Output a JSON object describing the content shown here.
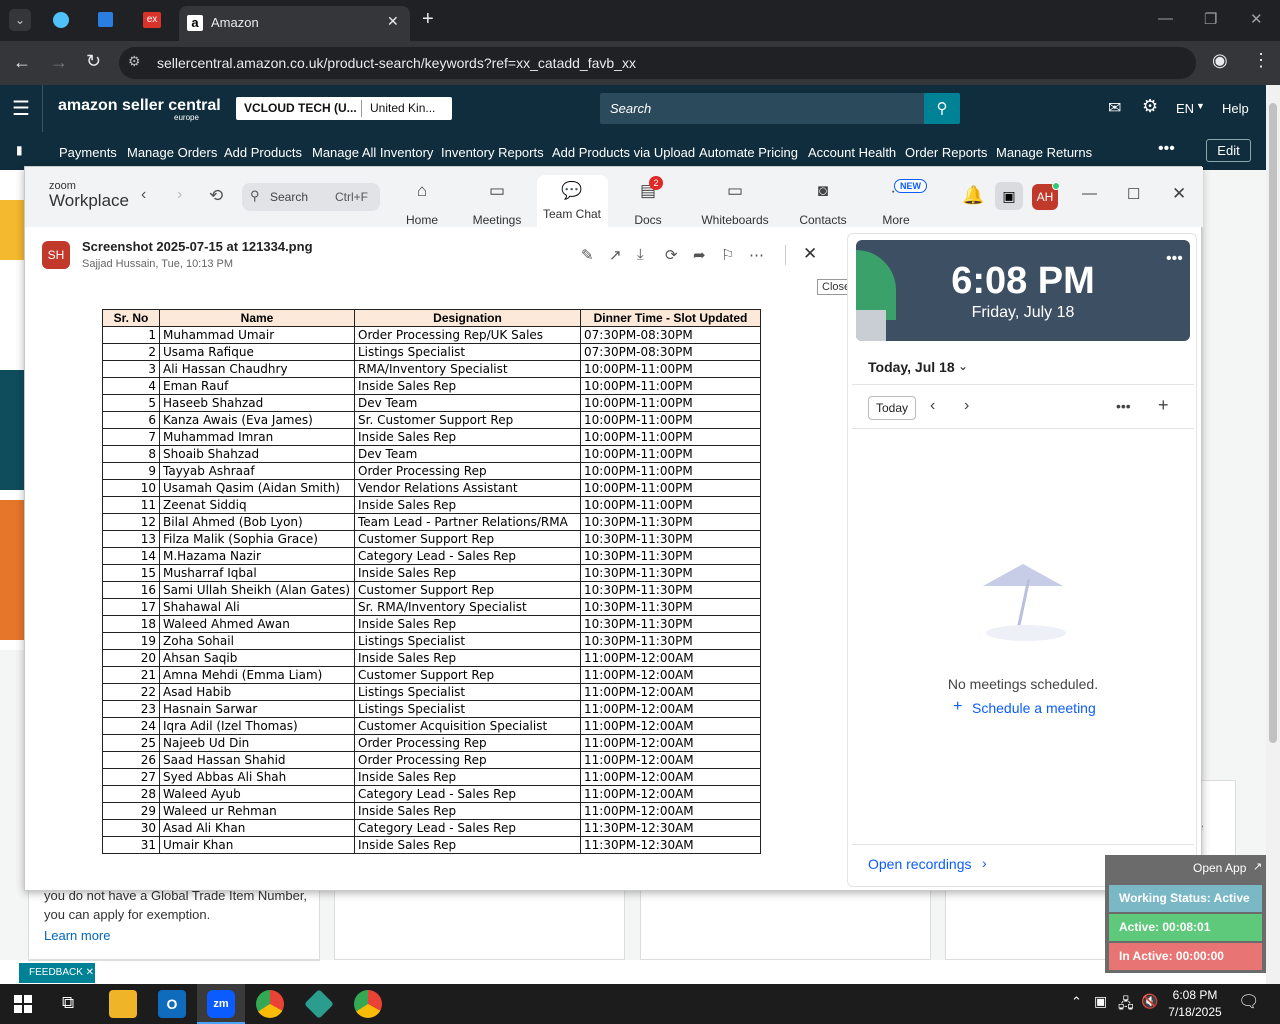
{
  "browser": {
    "tabs": [
      {
        "label": "Amazon"
      }
    ],
    "url": "sellercentral.amazon.co.uk/product-search/keywords?ref=xx_catadd_favb_xx"
  },
  "amazon": {
    "logo_main": "amazon seller central",
    "logo_sub": "europe",
    "account": "VCLOUD TECH (U...",
    "region": "United Kin...",
    "search_placeholder": "Search",
    "lang": "EN",
    "help": "Help",
    "edit": "Edit",
    "nav": [
      "Payments",
      "Manage Orders",
      "Add Products",
      "Manage All Inventory",
      "Inventory Reports",
      "Add Products via Upload",
      "Automate Pricing",
      "Account Health",
      "Order Reports",
      "Manage Returns"
    ],
    "body_text_1": "you do not have a Global Trade Item Number,",
    "body_text_2": "you can apply for exemption.",
    "learn_more": "Learn more",
    "feedback": "FEEDBACK",
    "partial_text": "e"
  },
  "zoom": {
    "brand_small": "zoom",
    "brand": "Workplace",
    "search": "Search",
    "search_shortcut": "Ctrl+F",
    "tabs": [
      "Home",
      "Meetings",
      "Team Chat",
      "Docs",
      "Whiteboards",
      "Contacts",
      "More"
    ],
    "docs_badge": "2",
    "more_badge": "NEW",
    "avatar": "AH",
    "viewer": {
      "avatar": "SH",
      "filename": "Screenshot 2025-07-15 at 121334.png",
      "meta": "Sajjad Hussain, Tue, 10:13 PM",
      "close_tooltip": "Close"
    },
    "table": {
      "headers": [
        "Sr. No",
        "Name",
        "Designation",
        "Dinner Time - Slot Updated"
      ],
      "rows": [
        [
          "1",
          "Muhammad Umair",
          "Order Processing Rep/UK Sales",
          "07:30PM-08:30PM"
        ],
        [
          "2",
          "Usama Rafique",
          "Listings Specialist",
          "07:30PM-08:30PM"
        ],
        [
          "3",
          "Ali Hassan Chaudhry",
          "RMA/Inventory Specialist",
          "10:00PM-11:00PM"
        ],
        [
          "4",
          "Eman Rauf",
          "Inside Sales Rep",
          "10:00PM-11:00PM"
        ],
        [
          "5",
          "Haseeb Shahzad",
          "Dev Team",
          "10:00PM-11:00PM"
        ],
        [
          "6",
          "Kanza Awais (Eva James)",
          "Sr. Customer Support Rep",
          "10:00PM-11:00PM"
        ],
        [
          "7",
          "Muhammad Imran",
          "Inside Sales Rep",
          "10:00PM-11:00PM"
        ],
        [
          "8",
          "Shoaib Shahzad",
          "Dev Team",
          "10:00PM-11:00PM"
        ],
        [
          "9",
          "Tayyab Ashraaf",
          "Order Processing Rep",
          "10:00PM-11:00PM"
        ],
        [
          "10",
          "Usamah Qasim (Aidan Smith)",
          "Vendor Relations Assistant",
          "10:00PM-11:00PM"
        ],
        [
          "11",
          "Zeenat Siddiq",
          "Inside Sales Rep",
          "10:00PM-11:00PM"
        ],
        [
          "12",
          "Bilal Ahmed (Bob Lyon)",
          "Team Lead - Partner Relations/RMA",
          "10:30PM-11:30PM"
        ],
        [
          "13",
          "Filza Malik (Sophia Grace)",
          "Customer Support Rep",
          "10:30PM-11:30PM"
        ],
        [
          "14",
          "M.Hazama Nazir",
          "Category Lead - Sales Rep",
          "10:30PM-11:30PM"
        ],
        [
          "15",
          "Musharraf Iqbal",
          "Inside Sales Rep",
          "10:30PM-11:30PM"
        ],
        [
          "16",
          "Sami Ullah Sheikh (Alan Gates)",
          "Customer Support Rep",
          "10:30PM-11:30PM"
        ],
        [
          "17",
          "Shahawal Ali",
          "Sr. RMA/Inventory Specialist",
          "10:30PM-11:30PM"
        ],
        [
          "18",
          "Waleed Ahmed Awan",
          "Inside Sales Rep",
          "10:30PM-11:30PM"
        ],
        [
          "19",
          "Zoha Sohail",
          "Listings Specialist",
          "10:30PM-11:30PM"
        ],
        [
          "20",
          "Ahsan Saqib",
          "Inside Sales Rep",
          "11:00PM-12:00AM"
        ],
        [
          "21",
          "Amna Mehdi (Emma Liam)",
          "Customer Support Rep",
          "11:00PM-12:00AM"
        ],
        [
          "22",
          "Asad Habib",
          "Listings Specialist",
          "11:00PM-12:00AM"
        ],
        [
          "23",
          "Hasnain Sarwar",
          "Listings Specialist",
          "11:00PM-12:00AM"
        ],
        [
          "24",
          "Iqra Adil (Izel Thomas)",
          "Customer Acquisition Specialist",
          "11:00PM-12:00AM"
        ],
        [
          "25",
          "Najeeb Ud Din",
          "Order Processing Rep",
          "11:00PM-12:00AM"
        ],
        [
          "26",
          "Saad Hassan Shahid",
          "Order Processing Rep",
          "11:00PM-12:00AM"
        ],
        [
          "27",
          "Syed Abbas Ali Shah",
          "Inside Sales Rep",
          "11:00PM-12:00AM"
        ],
        [
          "28",
          "Waleed Ayub",
          "Category Lead - Sales Rep",
          "11:00PM-12:00AM"
        ],
        [
          "29",
          "Waleed ur Rehman",
          "Inside Sales Rep",
          "11:00PM-12:00AM"
        ],
        [
          "30",
          "Asad Ali Khan",
          "Category Lead - Sales Rep",
          "11:30PM-12:30AM"
        ],
        [
          "31",
          "Umair Khan",
          "Inside Sales Rep",
          "11:30PM-12:30AM"
        ]
      ]
    },
    "calendar": {
      "time": "6:08 PM",
      "date": "Friday, July 18",
      "today_label": "Today, Jul 18",
      "today_button": "Today",
      "empty": "No meetings scheduled.",
      "schedule": "Schedule a meeting",
      "recordings": "Open recordings"
    }
  },
  "status_widget": {
    "open_app": "Open App",
    "working": "Working Status: Active",
    "active": "Active: 00:08:01",
    "inactive": "In Active: 00:00:00"
  },
  "taskbar": {
    "time": "6:08 PM",
    "date": "7/18/2025"
  },
  "colors": {
    "amazon_header": "#0f2d3c",
    "zoom_blue": "#0b5cff",
    "calendar_card": "#3d4f62",
    "active_green": "#5ec97a",
    "inactive_red": "#e87474"
  }
}
